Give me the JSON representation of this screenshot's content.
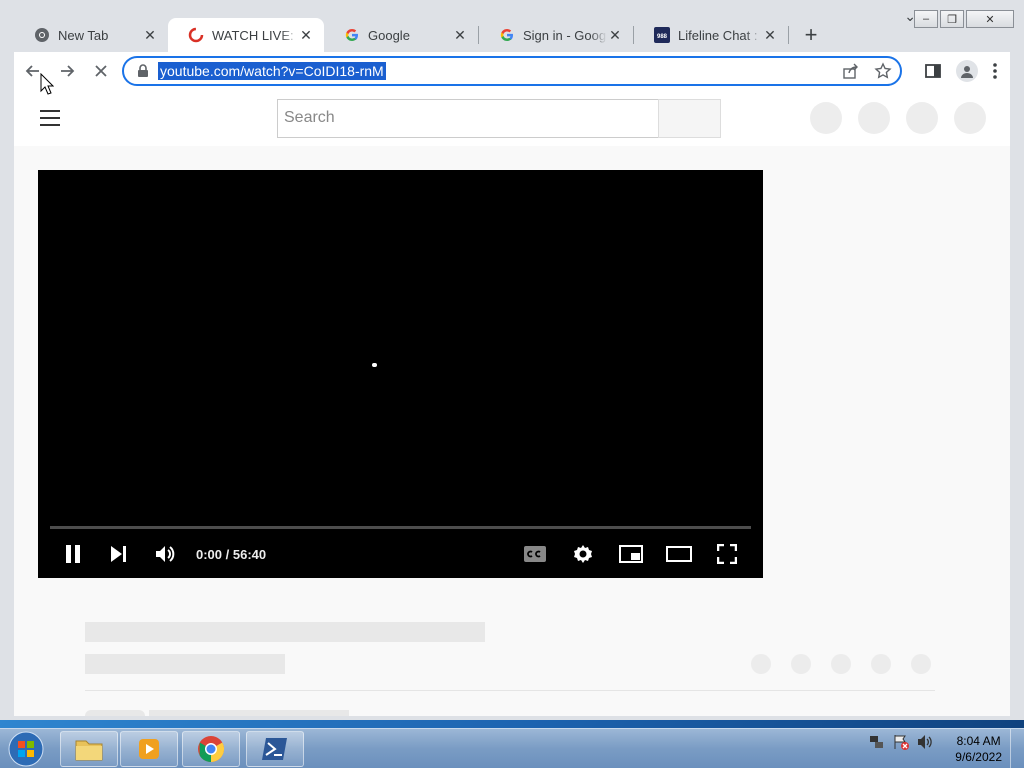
{
  "window_controls": {
    "minimize": "‒",
    "maximize": "❐",
    "close": "✕"
  },
  "tabs": [
    {
      "title": "New Tab",
      "icon": "chrome-icon",
      "active": false
    },
    {
      "title": "WATCH LIVE: Biden",
      "icon": "youtube-icon",
      "active": true
    },
    {
      "title": "Google",
      "icon": "google-icon",
      "active": false
    },
    {
      "title": "Sign in - Google Accounts",
      "icon": "google-icon",
      "active": false
    },
    {
      "title": "Lifeline Chat : Lifeline",
      "icon": "988-icon",
      "active": false
    }
  ],
  "tab_close_glyph": "✕",
  "new_tab_glyph": "+",
  "tab_search_glyph": "⌄",
  "favicon_988_text": "988",
  "address_bar": {
    "url": "youtube.com/watch?v=CoIDI18-rnM"
  },
  "youtube": {
    "search_placeholder": "Search"
  },
  "player": {
    "time": "0:00 / 56:40",
    "state": "playing",
    "progress": 0
  },
  "taskbar": {
    "clock_time": "8:04 AM",
    "clock_date": "9/6/2022",
    "apps": [
      "file-explorer",
      "media-player",
      "chrome",
      "powershell"
    ]
  }
}
